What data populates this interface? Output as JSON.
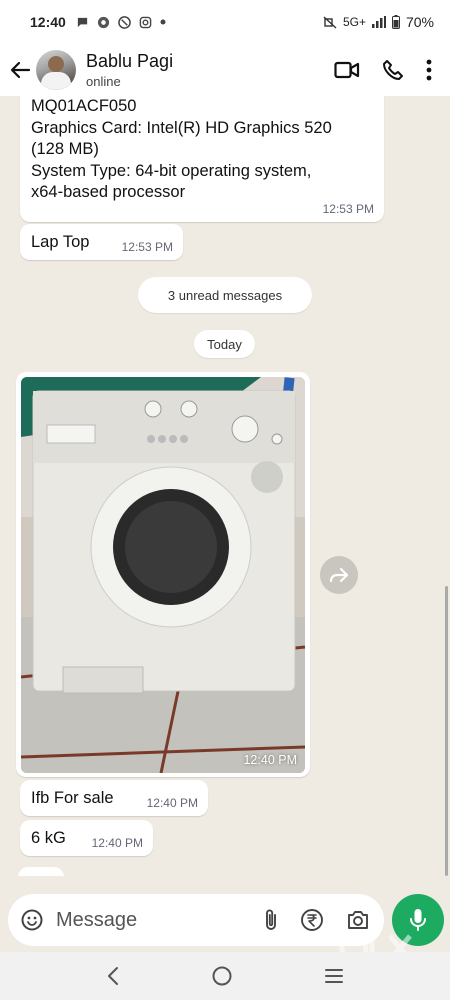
{
  "status_bar": {
    "time": "12:40",
    "network": "5G+",
    "battery": "70%",
    "notification_icons": [
      "chat-icon",
      "chrome-icon",
      "vpn-icon",
      "instagram-icon",
      "dot-icon"
    ]
  },
  "header": {
    "contact_name": "Bablu Pagi",
    "contact_status": "online",
    "actions": [
      "video-call-icon",
      "voice-call-icon",
      "more-vert-icon"
    ]
  },
  "messages": {
    "spec": {
      "lines": [
        "MQ01ACF050",
        "Graphics Card: Intel(R) HD Graphics 520",
        "(128 MB)",
        "System Type:  64-bit operating system,",
        "x64-based processor"
      ],
      "time": "12:53 PM"
    },
    "laptop": {
      "text": "Lap Top",
      "time": "12:53 PM"
    },
    "unread_banner": "3 unread messages",
    "date_divider": "Today",
    "image": {
      "time": "12:40 PM",
      "subject": "front-load washing machine photo"
    },
    "sale": {
      "text": "Ifb For sale",
      "time": "12:40 PM"
    },
    "weight": {
      "text": "6 kG",
      "time": "12:40 PM"
    }
  },
  "composer": {
    "placeholder": "Message",
    "icons": [
      "emoji-icon",
      "attach-icon",
      "rupee-icon",
      "camera-icon"
    ],
    "mic": "mic-icon"
  },
  "nav": [
    "back-nav-icon",
    "home-nav-icon",
    "recents-nav-icon"
  ],
  "colors": {
    "chat_bg": "#efeae2",
    "bubble": "#ffffff",
    "accent_green": "#1daa61"
  }
}
